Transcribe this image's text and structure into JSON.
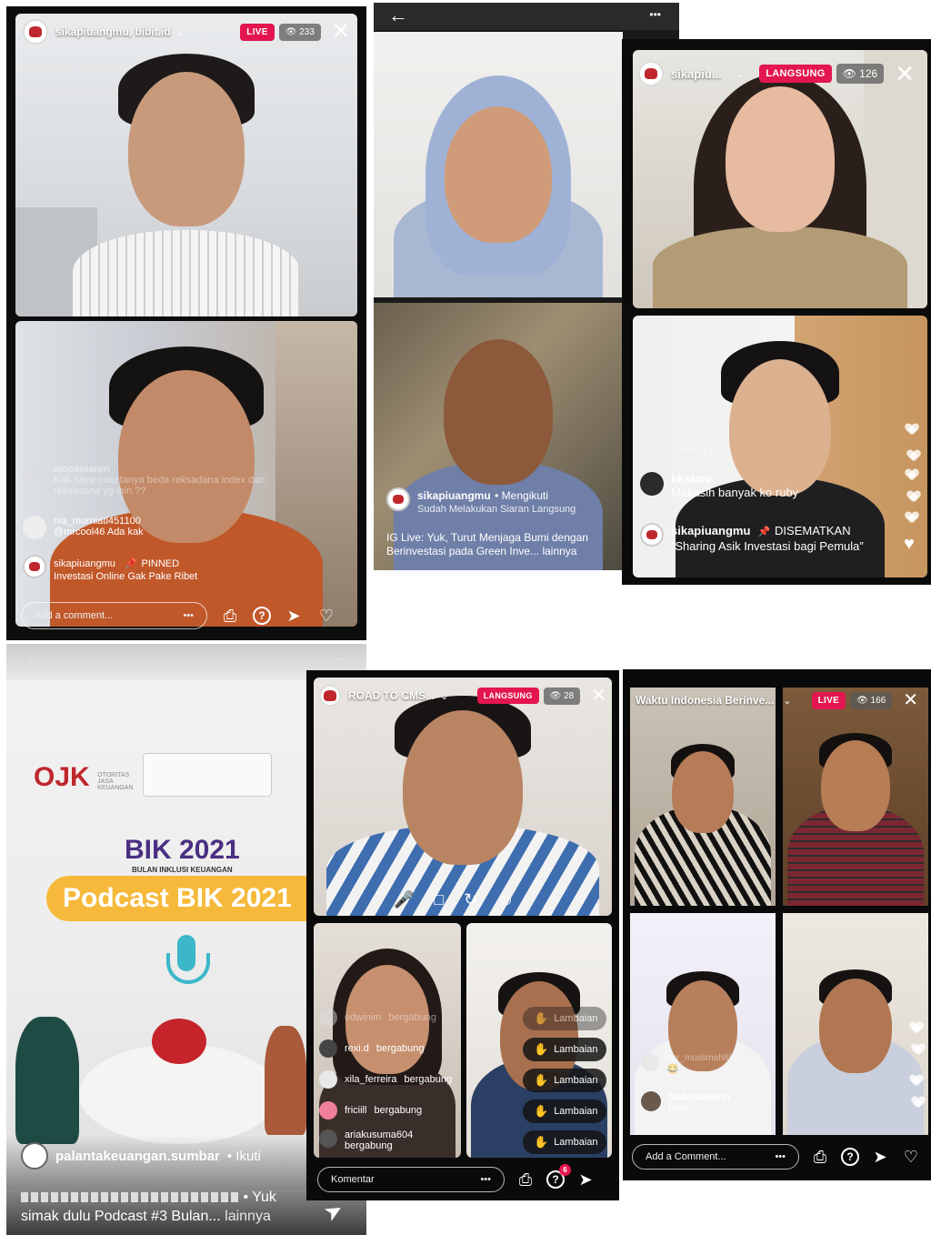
{
  "p1": {
    "username": "sikapiuangmu, bibit.id",
    "live_label": "LIVE",
    "viewers": "233",
    "comments": [
      {
        "name": "mocamaren",
        "text": "Kak saya mau tanya beda reksadana index dan reksadana yg lain ??"
      },
      {
        "name": "nia_murniati451100",
        "text": "@mrcool46 Ada kak"
      },
      {
        "name": "sikapiuangmu",
        "pinned": "PINNED",
        "text": "Investasi Online Gak Pake Ribet"
      }
    ],
    "comment_placeholder": "Add a comment...",
    "more": "•••"
  },
  "p2": {
    "host": "sikapiuangmu",
    "follow": "• Mengikuti",
    "status": "Sudah Melakukan Siaran Langsung",
    "caption": "IG Live: Yuk, Turut Menjaga Bumi dengan Berinvestasi pada Green Inve...",
    "more_link": "lainnya",
    "dots": "•••"
  },
  "p3": {
    "username": "sikapiu...",
    "live_label": "LANGSUNG",
    "viewers": "126",
    "comments": [
      {
        "name": "",
        "text": "Yeayyy"
      },
      {
        "name": "kkshnv",
        "text": "Makasih banyak ko ruby"
      },
      {
        "name": "sikapiuangmu",
        "pinned": "DISEMATKAN",
        "text": "“Sharing Asik Investasi bagi Pemula”"
      }
    ]
  },
  "p4": {
    "logo": "OJK",
    "logo_sub": "OTORITAS JASA KEUANGAN",
    "banner_title": "BIK 2021",
    "banner_sub": "BULAN INKLUSI KEUANGAN",
    "podcast": "Podcast BIK 2021",
    "host": "palantakeuangan.sumbar",
    "follow": "• Ikuti",
    "caption_a": "• Yuk",
    "caption_b": "simak dulu Podcast #3 Bulan...",
    "more_link": "lainnya",
    "dots": "•••"
  },
  "p5": {
    "username": "ROAD TO CMS...",
    "live_label": "LANGSUNG",
    "viewers": "28",
    "joins": [
      {
        "name": "edwinim",
        "suffix": "bergabung"
      },
      {
        "name": "rexi.d",
        "suffix": "bergabung"
      },
      {
        "name": "xila_ferreira",
        "suffix": "bergabung"
      },
      {
        "name": "friciill",
        "suffix": "bergabung"
      },
      {
        "name": "ariakusuma604",
        "suffix": "bergabung"
      }
    ],
    "wave_label": "Lambaian",
    "comment_placeholder": "Komentar",
    "question_badge": "6",
    "more": "•••"
  },
  "p6": {
    "username": "Waktu Indonesia Berinve...",
    "live_label": "LIVE",
    "viewers": "166",
    "comments": [
      {
        "name": "nur_muslimah89",
        "text": "😂"
      },
      {
        "name": "nadahuseinn",
        "text": "Halo"
      }
    ],
    "comment_placeholder": "Add a Comment...",
    "more": "•••"
  },
  "colors": {
    "live_pink": "#e3164f",
    "panel_dark": "#111111",
    "ojk_red": "#c0272d",
    "podcast_yellow": "#f6b93b",
    "wave_yellow": "#f3c21b"
  }
}
